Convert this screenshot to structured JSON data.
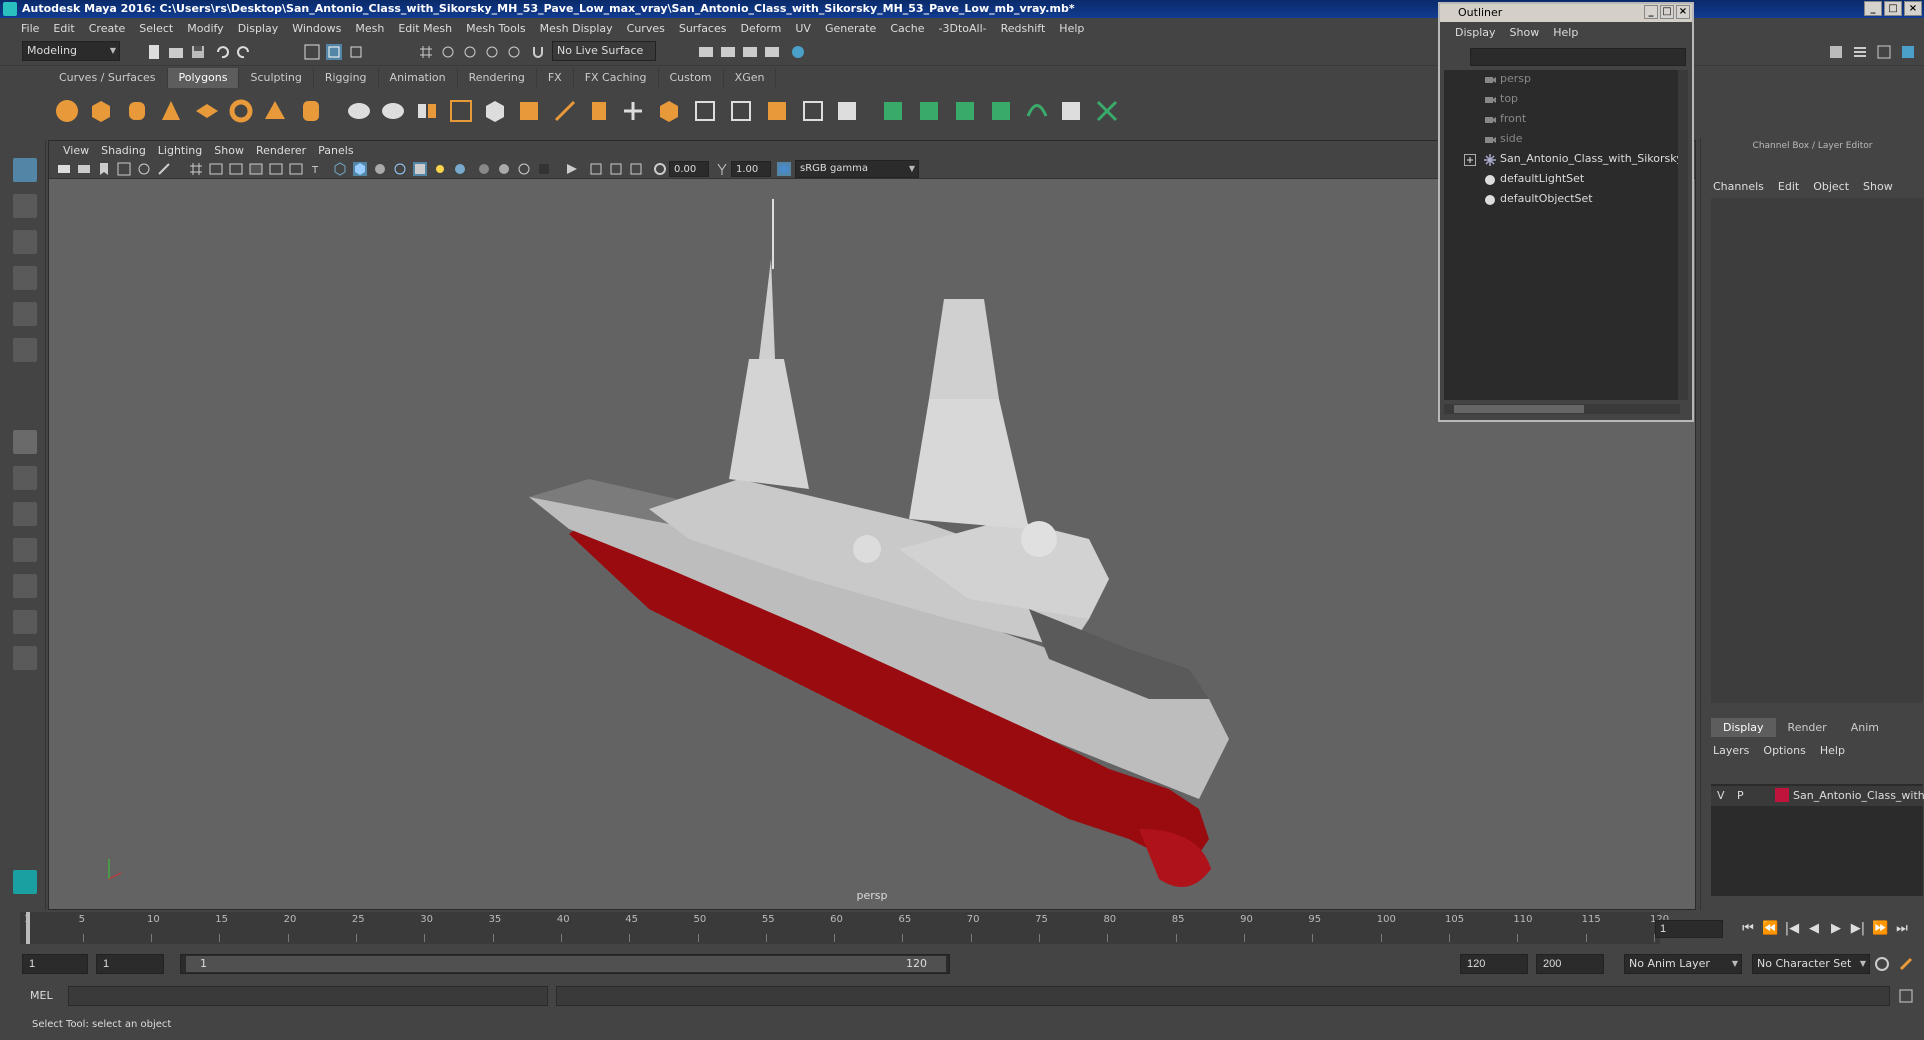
{
  "window": {
    "title": "Autodesk Maya 2016: C:\\Users\\rs\\Desktop\\San_Antonio_Class_with_Sikorsky_MH_53_Pave_Low_max_vray\\San_Antonio_Class_with_Sikorsky_MH_53_Pave_Low_mb_vray.mb*"
  },
  "menubar": [
    "File",
    "Edit",
    "Create",
    "Select",
    "Modify",
    "Display",
    "Windows",
    "Mesh",
    "Edit Mesh",
    "Mesh Tools",
    "Mesh Display",
    "Curves",
    "Surfaces",
    "Deform",
    "UV",
    "Generate",
    "Cache",
    "-3DtoAll-",
    "Redshift",
    "Help"
  ],
  "statusline": {
    "mode": "Modeling",
    "live_surface": "No Live Surface"
  },
  "shelf": {
    "tabs": [
      "Curves / Surfaces",
      "Polygons",
      "Sculpting",
      "Rigging",
      "Animation",
      "Rendering",
      "FX",
      "FX Caching",
      "Custom",
      "XGen"
    ],
    "active_tab": "Polygons"
  },
  "viewport": {
    "menu": [
      "View",
      "Shading",
      "Lighting",
      "Show",
      "Renderer",
      "Panels"
    ],
    "exposure": "0.00",
    "gamma": "1.00",
    "color_space": "sRGB gamma",
    "camera_label": "persp"
  },
  "outliner": {
    "title": "Outliner",
    "menu": [
      "Display",
      "Show",
      "Help"
    ],
    "items": [
      {
        "label": "persp",
        "kind": "camera"
      },
      {
        "label": "top",
        "kind": "camera"
      },
      {
        "label": "front",
        "kind": "camera"
      },
      {
        "label": "side",
        "kind": "camera"
      },
      {
        "label": "San_Antonio_Class_with_Sikorsky",
        "kind": "group"
      },
      {
        "label": "defaultLightSet",
        "kind": "set"
      },
      {
        "label": "defaultObjectSet",
        "kind": "set"
      }
    ]
  },
  "channel_box": {
    "header": "Channel Box / Layer Editor",
    "menu": [
      "Channels",
      "Edit",
      "Object",
      "Show"
    ]
  },
  "layer_editor": {
    "tabs": [
      "Display",
      "Render",
      "Anim"
    ],
    "active_tab": "Display",
    "menu": [
      "Layers",
      "Options",
      "Help"
    ],
    "layer": {
      "v": "V",
      "p": "P",
      "name": "San_Antonio_Class_with",
      "color": "#c0143c"
    }
  },
  "timeline": {
    "ticks": [
      "1",
      "5",
      "10",
      "15",
      "20",
      "25",
      "30",
      "35",
      "40",
      "45",
      "50",
      "55",
      "60",
      "65",
      "70",
      "75",
      "80",
      "85",
      "90",
      "95",
      "100",
      "105",
      "110",
      "115",
      "120"
    ],
    "current_frame": "1"
  },
  "range": {
    "start": "1",
    "anim_start": "1",
    "range_start": "1",
    "range_end": "120",
    "anim_end": "120",
    "end": "200",
    "anim_layer": "No Anim Layer",
    "character_set": "No Character Set"
  },
  "command_line": {
    "label": "MEL"
  },
  "help_line": "Select Tool: select an object"
}
